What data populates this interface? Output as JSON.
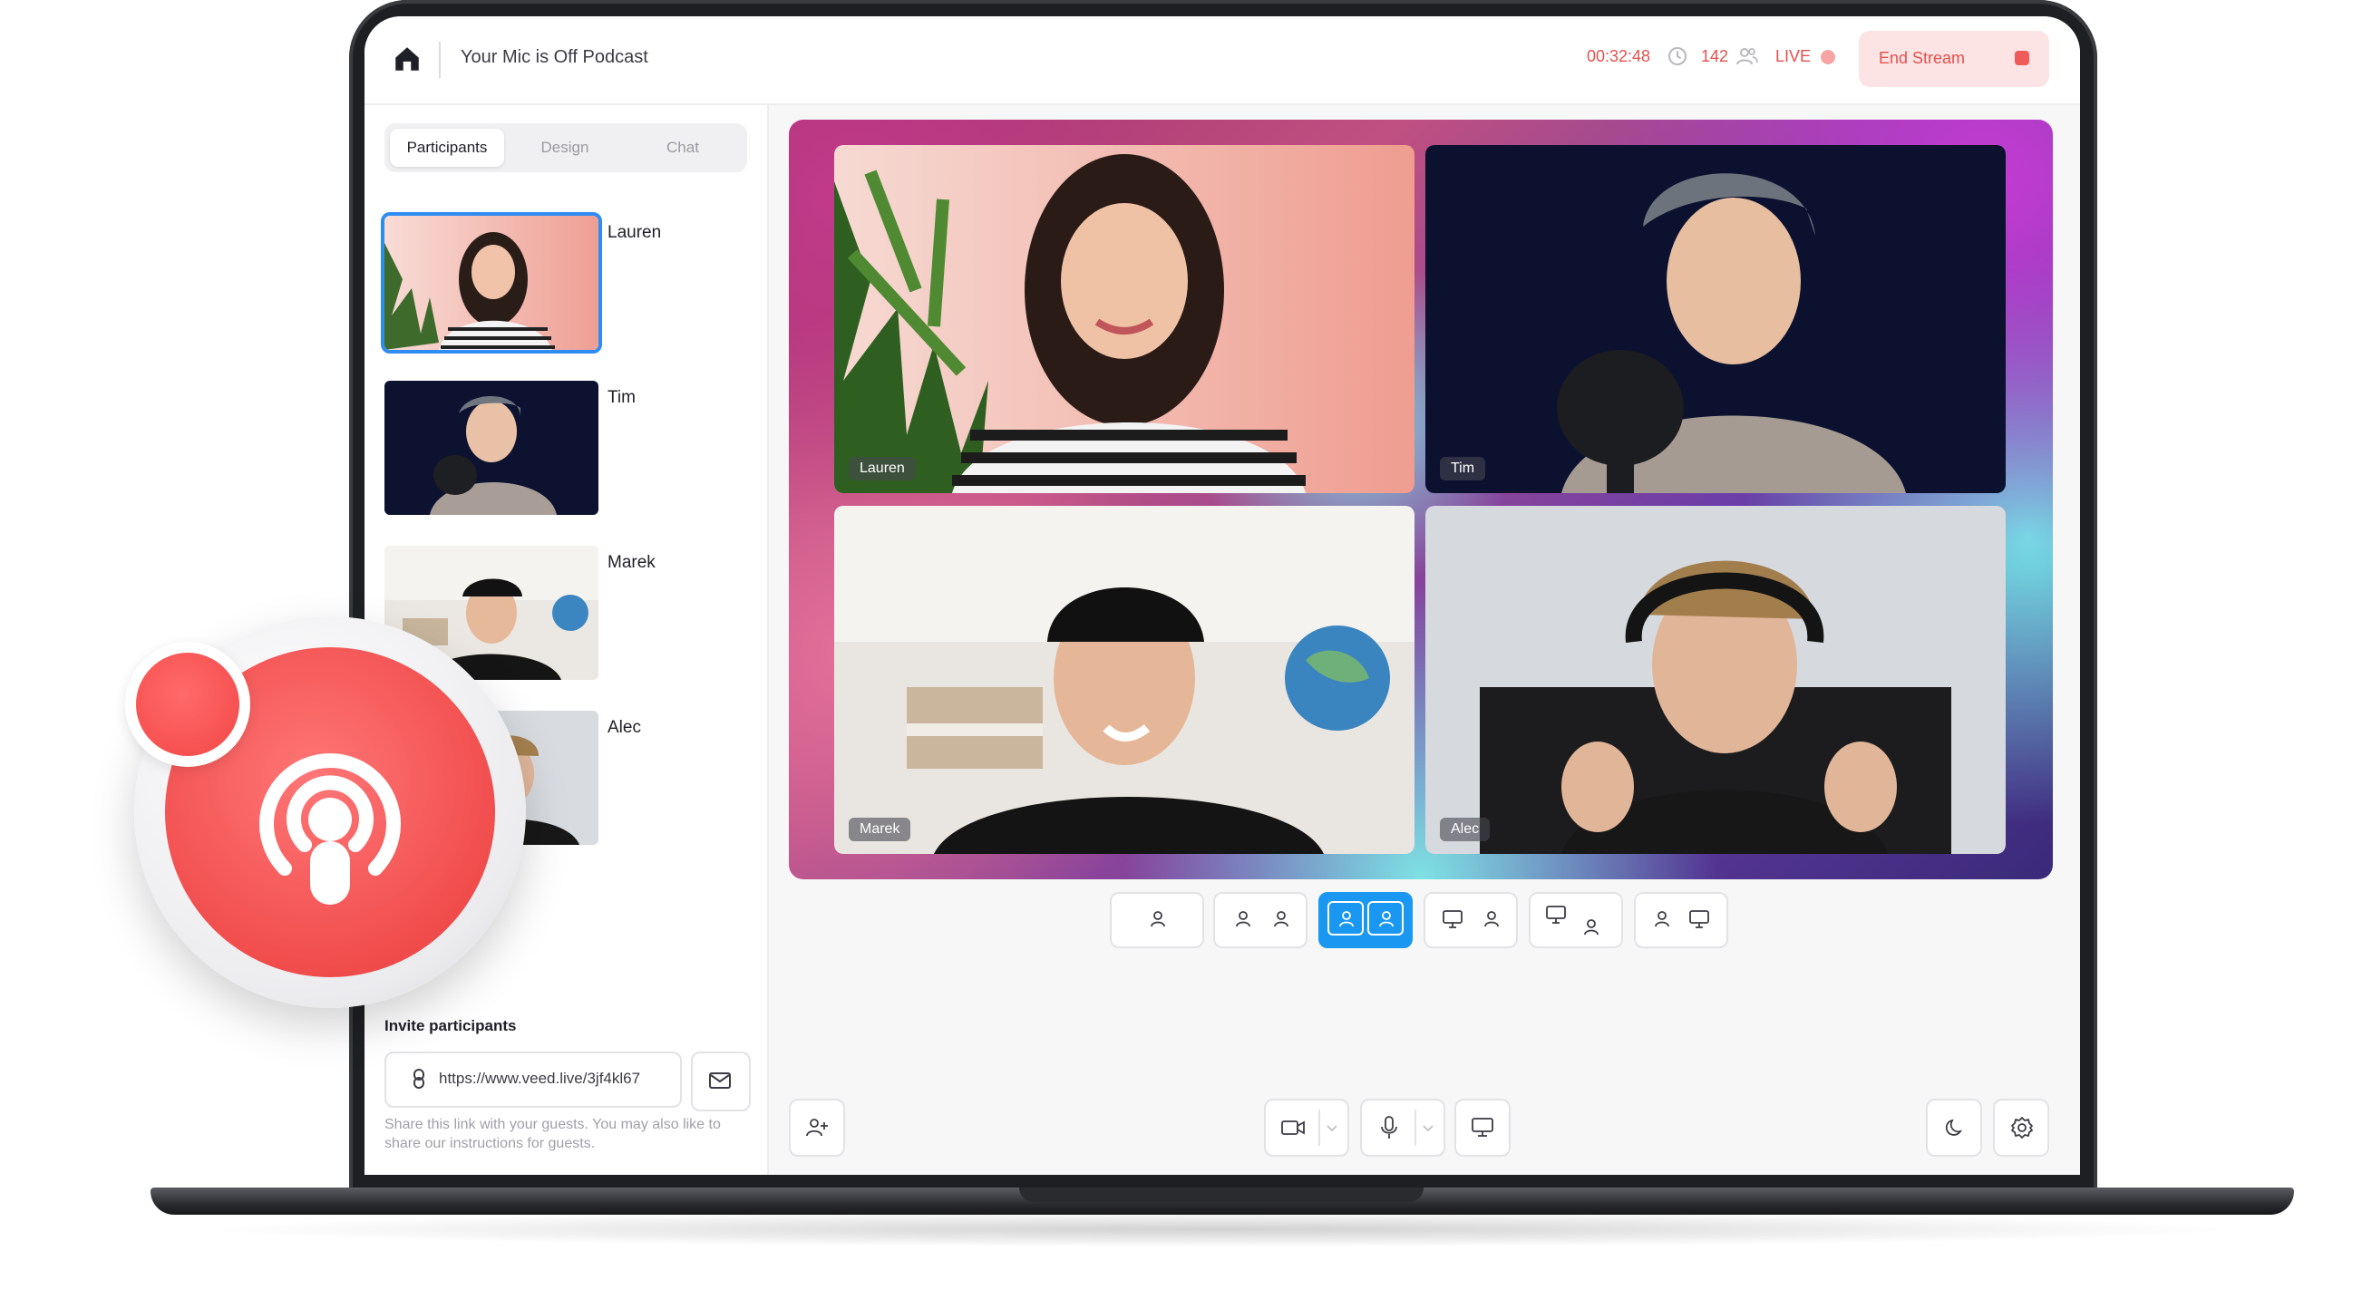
{
  "header": {
    "podcast_title": "Your Mic is Off Podcast",
    "timer": "00:32:48",
    "viewer_count": "142",
    "live_label": "LIVE",
    "end_stream_label": "End Stream"
  },
  "tabs": [
    {
      "label": "Participants",
      "active": true
    },
    {
      "label": "Design",
      "active": false
    },
    {
      "label": "Chat",
      "active": false
    }
  ],
  "participants": [
    {
      "name": "Lauren",
      "selected": true
    },
    {
      "name": "Tim",
      "selected": false
    },
    {
      "name": "Marek",
      "selected": false
    },
    {
      "name": "Alec",
      "selected": false
    }
  ],
  "stage": {
    "tiles": [
      {
        "label": "Lauren"
      },
      {
        "label": "Tim"
      },
      {
        "label": "Marek"
      },
      {
        "label": "Alec"
      }
    ]
  },
  "invite": {
    "heading": "Invite participants",
    "link": "https://www.veed.live/3jf4kl67",
    "hint": "Share this link with your guests. You may also like to share our instructions for guests."
  },
  "colors": {
    "accent_blue": "#1a97f0",
    "live_red": "#e2504f",
    "end_stream_bg": "#fde4e4",
    "badge_red": "#f04a4a"
  },
  "icons": {
    "home": "home-icon",
    "clock": "clock-icon",
    "viewers": "users-icon",
    "link": "link-icon",
    "mail": "mail-icon",
    "camera": "video-camera-icon",
    "mic": "microphone-icon",
    "screen": "monitor-icon",
    "moon": "moon-icon",
    "settings": "gear-icon",
    "add_user": "add-user-icon",
    "podcast": "podcast-icon"
  }
}
